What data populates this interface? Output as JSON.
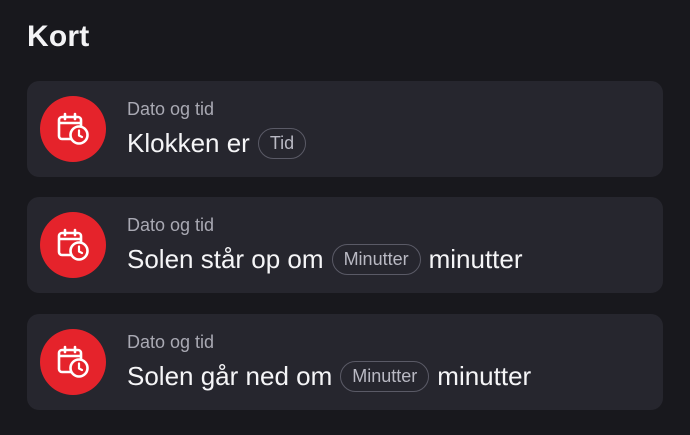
{
  "page": {
    "title": "Kort"
  },
  "colors": {
    "background": "#18181d",
    "card": "#26262e",
    "accent": "#e5232b"
  },
  "cards": [
    {
      "icon": "calendar-clock-icon",
      "category": "Dato og tid",
      "text_before": "Klokken er",
      "pill": "Tid",
      "text_after": ""
    },
    {
      "icon": "calendar-clock-icon",
      "category": "Dato og tid",
      "text_before": "Solen står op om",
      "pill": "Minutter",
      "text_after": "minutter"
    },
    {
      "icon": "calendar-clock-icon",
      "category": "Dato og tid",
      "text_before": "Solen går ned om",
      "pill": "Minutter",
      "text_after": "minutter"
    }
  ]
}
